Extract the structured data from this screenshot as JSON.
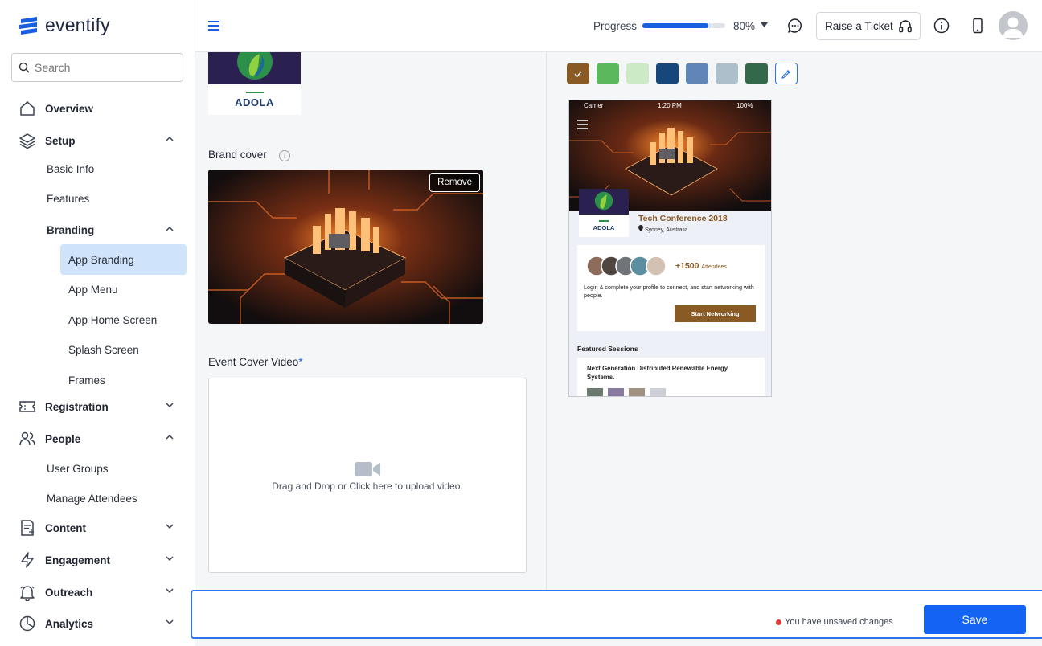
{
  "app": {
    "name": "eventify"
  },
  "search": {
    "placeholder": "Search"
  },
  "sidebar": {
    "overview": "Overview",
    "setup": "Setup",
    "basic_info": "Basic Info",
    "features": "Features",
    "branding": "Branding",
    "app_branding": "App Branding",
    "app_menu": "App Menu",
    "app_home_screen": "App Home Screen",
    "splash_screen": "Splash Screen",
    "frames": "Frames",
    "registration": "Registration",
    "people": "People",
    "user_groups": "User Groups",
    "manage_attendees": "Manage Attendees",
    "content": "Content",
    "engagement": "Engagement",
    "outreach": "Outreach",
    "analytics": "Analytics"
  },
  "header": {
    "progress_label": "Progress",
    "progress_value": 80,
    "progress_pct": "80%",
    "ticket_label": "Raise a Ticket"
  },
  "form": {
    "logo_text": "ADOLA",
    "brand_cover_label": "Brand cover",
    "remove_label": "Remove",
    "video_label": "Event Cover Video",
    "required_mark": "*",
    "video_hint": "Drag and Drop or Click here to upload video."
  },
  "colors": {
    "swatches": [
      "#8a5a24",
      "#5cb85c",
      "#cdeac6",
      "#17467a",
      "#5f86b6",
      "#aebfcc",
      "#33694a"
    ],
    "accent": "#1463f3"
  },
  "preview": {
    "carrier": "Carrier",
    "time": "1:20 PM",
    "battery": "100%",
    "logo_text": "ADOLA",
    "event_title": "Tech Conference 2018",
    "location": "Sydney, Australia",
    "attendee_count": "+1500",
    "attendee_word": "Attendees",
    "description": "Login & complete your profile to connect, and start networking with people.",
    "network_button": "Start Networking",
    "featured_heading": "Featured Sessions",
    "session_title": "Next Generation Distributed Renewable Energy Systems."
  },
  "footer": {
    "unsaved": "You have unsaved changes",
    "save": "Save"
  }
}
